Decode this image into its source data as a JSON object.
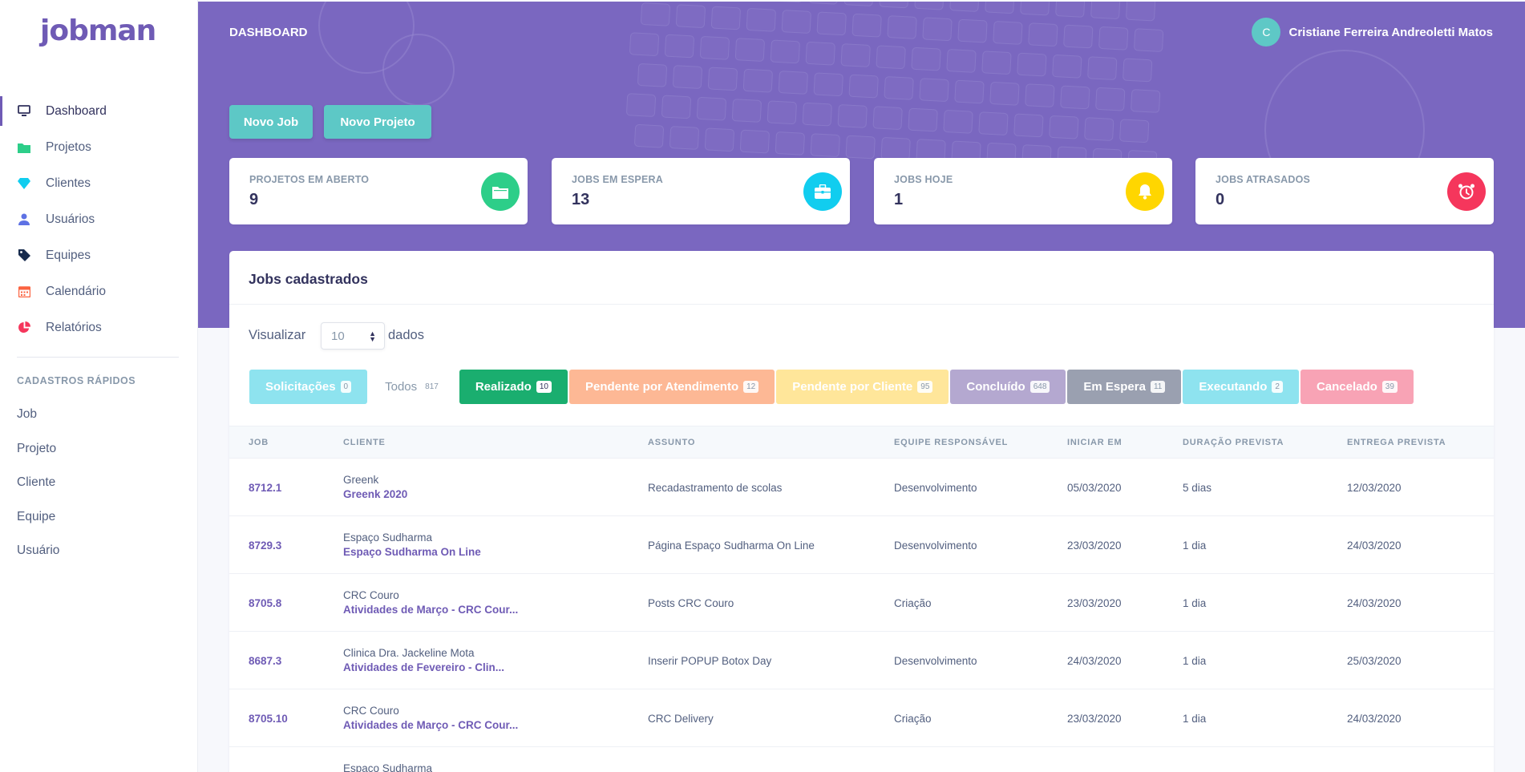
{
  "app": {
    "logo": "jobman"
  },
  "sidebar": {
    "items": [
      {
        "label": "Dashboard",
        "icon": "monitor-icon",
        "color": "#32325d",
        "active": true
      },
      {
        "label": "Projetos",
        "icon": "folder-icon",
        "color": "#2dce89"
      },
      {
        "label": "Clientes",
        "icon": "diamond-icon",
        "color": "#11cdef"
      },
      {
        "label": "Usuários",
        "icon": "user-icon",
        "color": "#5e72e4"
      },
      {
        "label": "Equipes",
        "icon": "tag-icon",
        "color": "#172b4d"
      },
      {
        "label": "Calendário",
        "icon": "calendar-icon",
        "color": "#fb6340"
      },
      {
        "label": "Relatórios",
        "icon": "pie-chart-icon",
        "color": "#f5365c"
      }
    ],
    "quick_title": "CADASTROS RÁPIDOS",
    "quick_items": [
      "Job",
      "Projeto",
      "Cliente",
      "Equipe",
      "Usuário"
    ]
  },
  "header": {
    "title": "DASHBOARD",
    "user_initial": "C",
    "user_name": "Cristiane Ferreira Andreoletti Matos",
    "buttons": {
      "new_job": "Novo Job",
      "new_project": "Novo Projeto"
    }
  },
  "stats": [
    {
      "label": "PROJETOS EM ABERTO",
      "value": "9",
      "icon": "folder-icon",
      "color": "#2dce89"
    },
    {
      "label": "JOBS EM ESPERA",
      "value": "13",
      "icon": "briefcase-icon",
      "color": "#11cdef"
    },
    {
      "label": "JOBS HOJE",
      "value": "1",
      "icon": "bell-icon",
      "color": "#ffd600"
    },
    {
      "label": "JOBS ATRASADOS",
      "value": "0",
      "icon": "alarm-clock-icon",
      "color": "#f5365c"
    }
  ],
  "jobs": {
    "title": "Jobs cadastrados",
    "show_label": "Visualizar",
    "show_value": "10",
    "show_suffix": "dados",
    "tabs": [
      {
        "label": "Solicitações",
        "count": "0",
        "bg": "#8ee3ef"
      },
      {
        "label": "Todos",
        "count": "817",
        "bg": "#ffffff"
      },
      {
        "label": "Realizado",
        "count": "10",
        "bg": "#1aae6f"
      },
      {
        "label": "Pendente por Atendimento",
        "count": "12",
        "bg": "#fdb895"
      },
      {
        "label": "Pendente por Cliente",
        "count": "95",
        "bg": "#ffe69a"
      },
      {
        "label": "Concluído",
        "count": "648",
        "bg": "#b4a8d0"
      },
      {
        "label": "Em Espera",
        "count": "11",
        "bg": "#9aa0b0"
      },
      {
        "label": "Executando",
        "count": "2",
        "bg": "#8ee3ef"
      },
      {
        "label": "Cancelado",
        "count": "39",
        "bg": "#f8a3b5"
      }
    ],
    "columns": [
      "JOB",
      "CLIENTE",
      "ASSUNTO",
      "EQUIPE RESPONSÁVEL",
      "INICIAR EM",
      "DURAÇÃO PREVISTA",
      "ENTREGA PREVISTA"
    ],
    "rows": [
      {
        "job": "8712.1",
        "client": "Greenk",
        "project": "Greenk 2020",
        "subject": "Recadastramento de scolas",
        "team": "Desenvolvimento",
        "start": "05/03/2020",
        "duration": "5 dias",
        "delivery": "12/03/2020"
      },
      {
        "job": "8729.3",
        "client": "Espaço Sudharma",
        "project": "Espaço Sudharma On Line",
        "subject": "Página Espaço Sudharma On Line",
        "team": "Desenvolvimento",
        "start": "23/03/2020",
        "duration": "1 dia",
        "delivery": "24/03/2020"
      },
      {
        "job": "8705.8",
        "client": "CRC Couro",
        "project": "Atividades de Março - CRC Cour...",
        "subject": "Posts CRC Couro",
        "team": "Criação",
        "start": "23/03/2020",
        "duration": "1 dia",
        "delivery": "24/03/2020"
      },
      {
        "job": "8687.3",
        "client": "Clinica Dra. Jackeline Mota",
        "project": "Atividades de Fevereiro - Clin...",
        "subject": "Inserir POPUP Botox Day",
        "team": "Desenvolvimento",
        "start": "24/03/2020",
        "duration": "1 dia",
        "delivery": "25/03/2020"
      },
      {
        "job": "8705.10",
        "client": "CRC Couro",
        "project": "Atividades de Março - CRC Cour...",
        "subject": "CRC Delivery",
        "team": "Criação",
        "start": "23/03/2020",
        "duration": "1 dia",
        "delivery": "24/03/2020"
      },
      {
        "job": "",
        "client": "Espaço Sudharma",
        "project": "",
        "subject": "",
        "team": "",
        "start": "",
        "duration": "",
        "delivery": ""
      }
    ]
  }
}
